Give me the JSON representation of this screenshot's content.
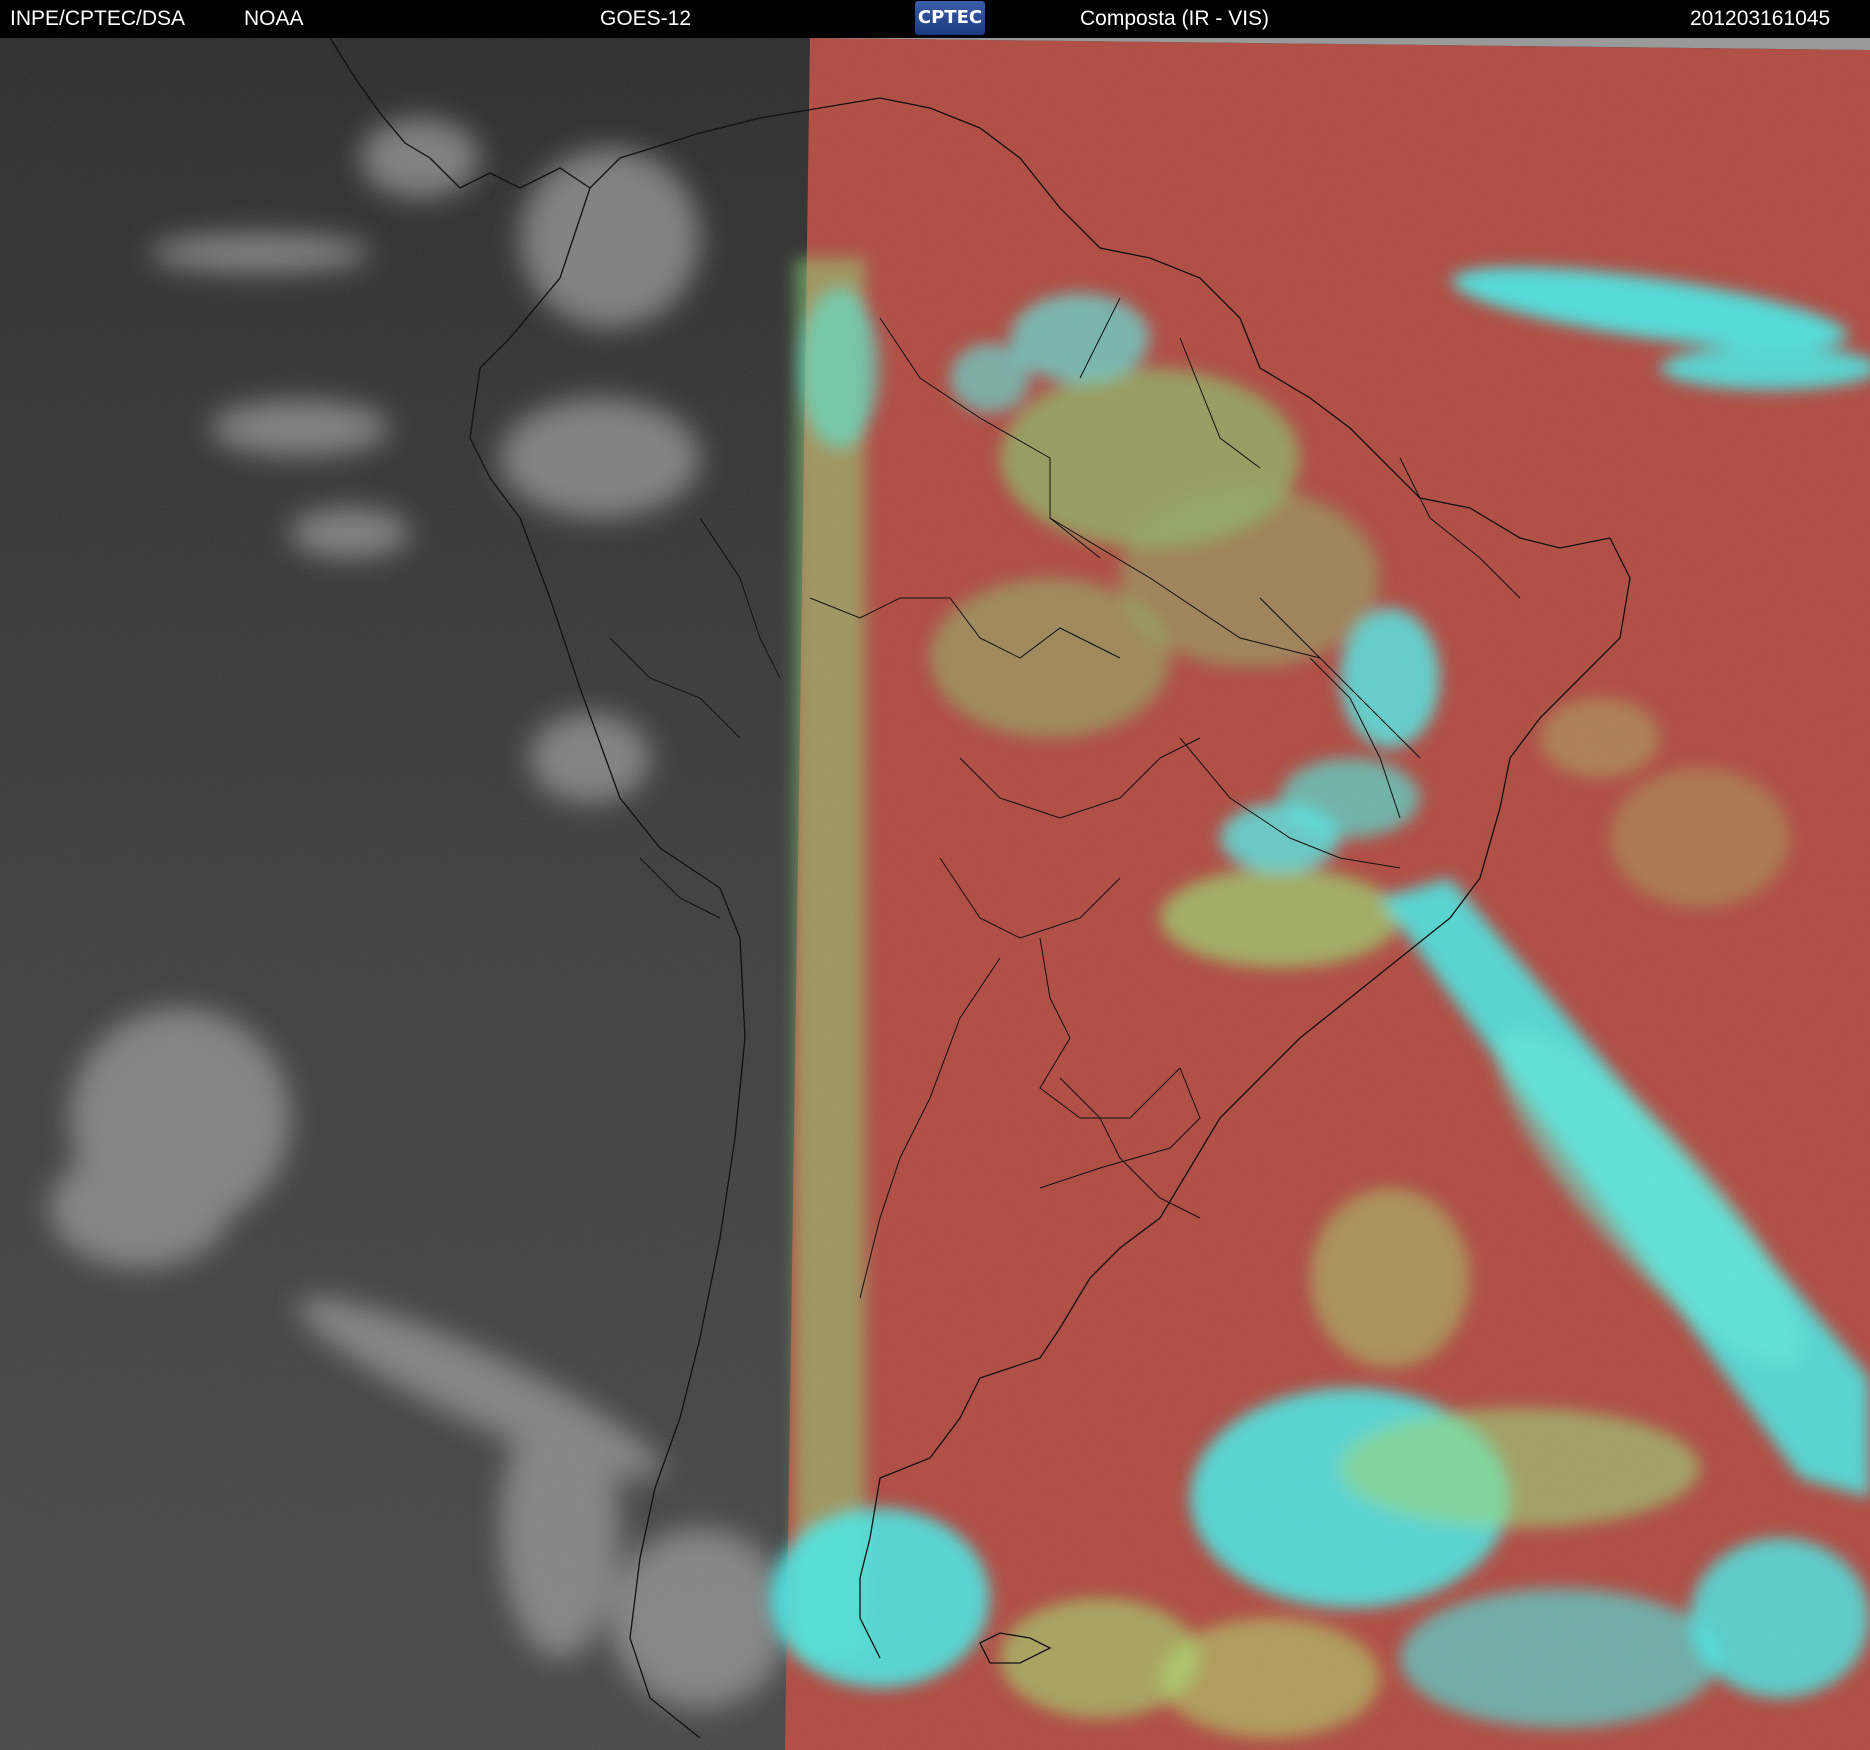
{
  "header": {
    "agency": "INPE/CPTEC/DSA",
    "partner": "NOAA",
    "satellite": "GOES-12",
    "logo_text": "CPTEC",
    "product": "Composta (IR - VIS)",
    "timestamp": "201203161045"
  },
  "colors": {
    "background": "#000000",
    "ir_gray": "#3c3c3c",
    "composite_red": "#b04a40",
    "cloud_cyan": "#3ff0ee",
    "cloud_green": "#9be070",
    "border_lines": "#111111"
  }
}
